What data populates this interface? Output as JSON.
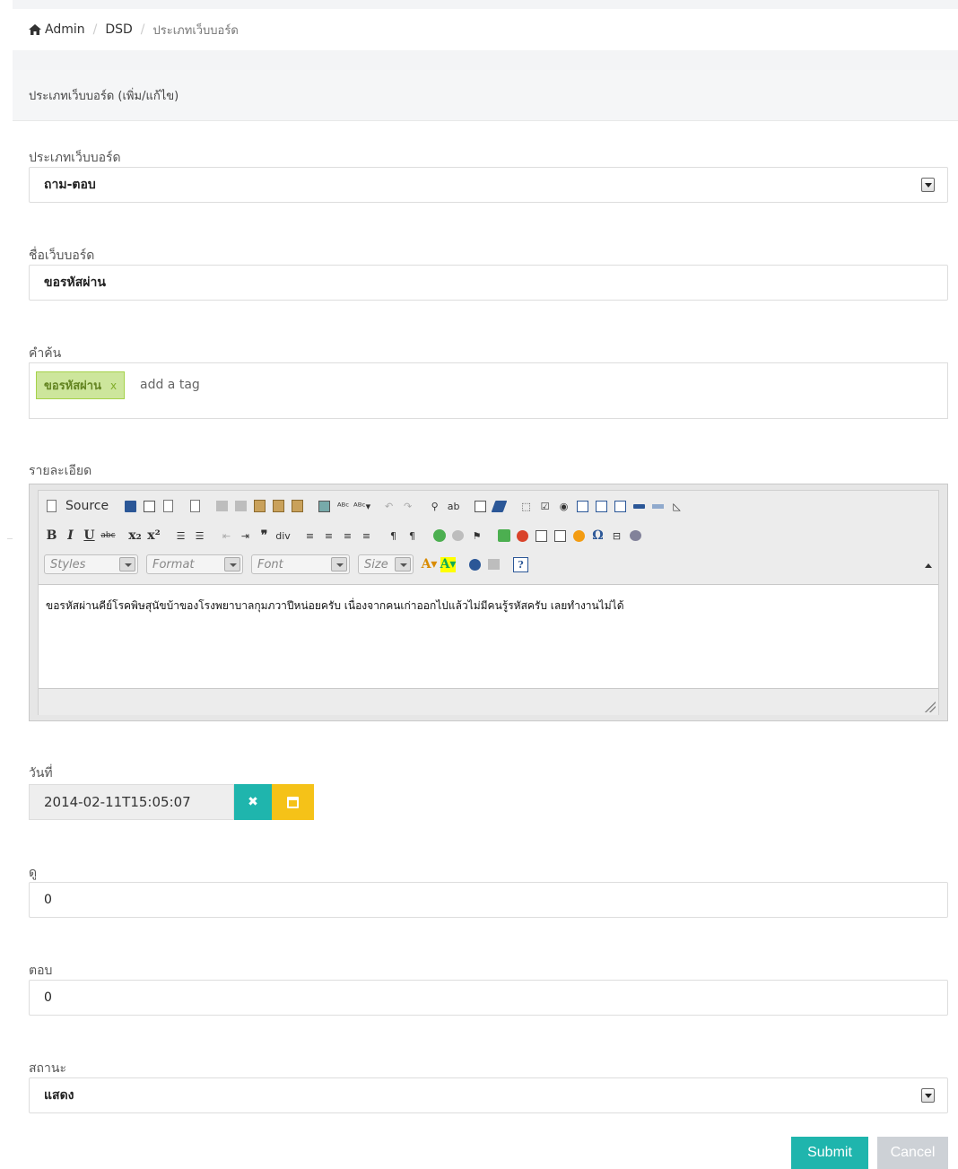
{
  "breadcrumb": {
    "items": [
      "Admin",
      "DSD"
    ],
    "active": "ประเภทเว็บบอร์ด"
  },
  "panel": {
    "title": "ประเภทเว็บบอร์ด (เพิ่ม/แก้ไข)"
  },
  "form": {
    "board_type": {
      "label": "ประเภทเว็บบอร์ด",
      "value": "ถาม-ตอบ"
    },
    "board_name": {
      "label": "ชื่อเว็บบอร์ด",
      "value": "ขอรหัสผ่าน"
    },
    "keywords": {
      "label": "คำค้น",
      "tags": [
        {
          "text": "ขอรหัสผ่าน",
          "remove": "x"
        }
      ],
      "placeholder": "add a tag"
    },
    "detail": {
      "label": "รายละเอียด",
      "source_label": "Source",
      "combos": [
        "Styles",
        "Format",
        "Font",
        "Size"
      ],
      "content": "ขอรหัสผ่านคีย์โรคพิษสุนัขบ้าของโรงพยาบาลกุมภวาปีหน่อยครับ เนื่องจากคนเก่าออกไปแล้วไม่มีคนรู้รหัสครับ เลยทำงานไม่ได้"
    },
    "date": {
      "label": "วันที่",
      "value": "2014-02-11T15:05:07",
      "clear_icon": "times-icon",
      "calendar_icon": "calendar-icon"
    },
    "views": {
      "label": "ดู",
      "value": "0"
    },
    "replies": {
      "label": "ตอบ",
      "value": "0"
    },
    "status": {
      "label": "สถานะ",
      "value": "แสดง"
    },
    "submit_label": "Submit",
    "cancel_label": "Cancel"
  },
  "colors": {
    "accent": "#1fb5ad",
    "warning": "#f5c218",
    "tag_bg": "#cde69c",
    "cancel": "#cdd1d6"
  }
}
